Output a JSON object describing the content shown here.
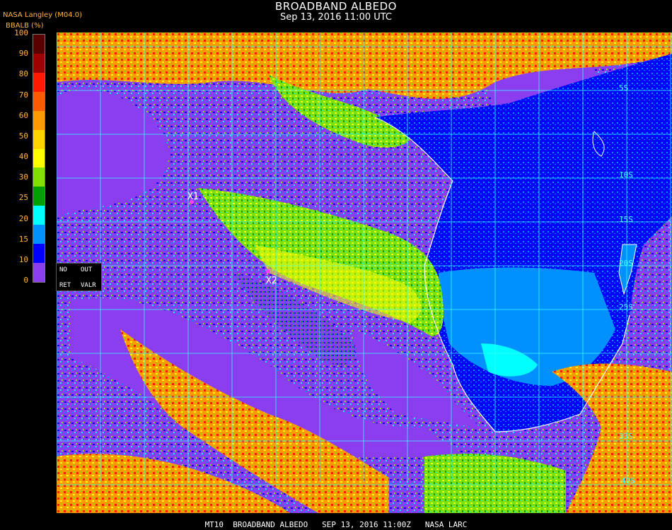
{
  "header": {
    "title": "BROADBAND ALBEDO",
    "datetime": "Sep 13, 2016 11:00 UTC",
    "producer": "NASA Langley (M04.0)"
  },
  "colorbar": {
    "unit_label": "BBALB (%)",
    "ticks": [
      "100",
      "90",
      "80",
      "70",
      "60",
      "50",
      "40",
      "30",
      "25",
      "20",
      "15",
      "10",
      "0"
    ],
    "colors": [
      "#5a0000",
      "#a00000",
      "#ff1a00",
      "#ff5a00",
      "#ff9a00",
      "#ffd200",
      "#ffff00",
      "#80e000",
      "#00a000",
      "#00ffff",
      "#0090ff",
      "#0000ff",
      "#8a3ef0"
    ]
  },
  "no_retrieval_box": {
    "line1_left": "NO",
    "line1_right": "OUT",
    "line2_left": "RET",
    "line2_right": "VALR"
  },
  "map": {
    "colors": {
      "clear_ocean": "#8a3ef0",
      "land_low": "#0090ff",
      "land_dark": "#0000ff",
      "desert": "#00ffff",
      "cloud_low": "#80e000",
      "cloud_mid": "#ffff00",
      "cloud_high": "#ff9a00",
      "cloud_thick": "#ff1a00",
      "grid": "#33ffff",
      "coast": "#ffffff"
    },
    "points": [
      {
        "label": "X1"
      },
      {
        "label": "X2"
      }
    ],
    "lat_labels": [
      "5S",
      "10S",
      "15S",
      "20S",
      "25S",
      "35S",
      "40S"
    ]
  },
  "footer": {
    "text": "MT10  BROADBAND ALBEDO   SEP 13, 2016 11:00Z   NASA LARC"
  }
}
